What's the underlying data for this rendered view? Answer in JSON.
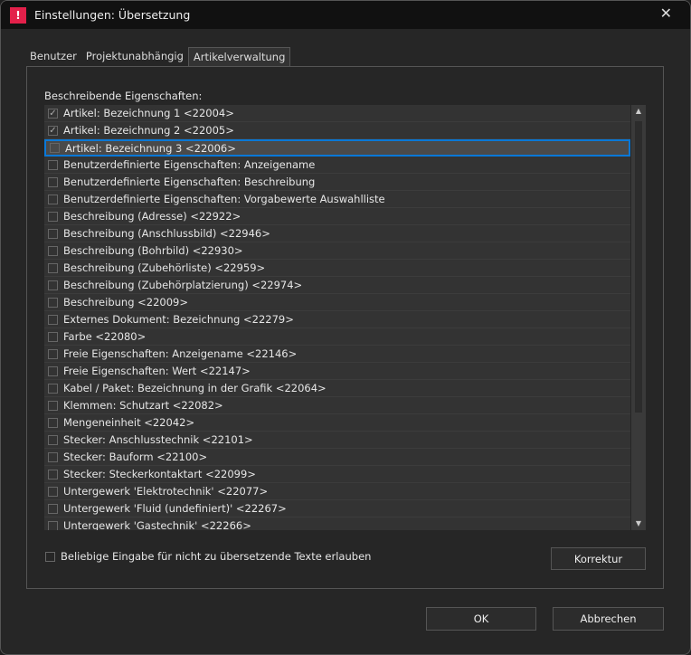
{
  "window": {
    "title": "Einstellungen: Übersetzung",
    "logo": "!",
    "close": "✕"
  },
  "tabs": [
    {
      "label": "Benutzer"
    },
    {
      "label": "Projektunabhängig"
    },
    {
      "label": "Artikelverwaltung"
    }
  ],
  "list_label": "Beschreibende Eigenschaften:",
  "items": [
    {
      "label": "Artikel: Bezeichnung 1 <22004>",
      "checked": true
    },
    {
      "label": "Artikel: Bezeichnung 2 <22005>",
      "checked": true
    },
    {
      "label": "Artikel: Bezeichnung 3 <22006>",
      "checked": false
    },
    {
      "label": "Benutzerdefinierte Eigenschaften: Anzeigename",
      "checked": false
    },
    {
      "label": "Benutzerdefinierte Eigenschaften: Beschreibung",
      "checked": false
    },
    {
      "label": "Benutzerdefinierte Eigenschaften: Vorgabewerte Auswahlliste",
      "checked": false
    },
    {
      "label": "Beschreibung (Adresse) <22922>",
      "checked": false
    },
    {
      "label": "Beschreibung (Anschlussbild) <22946>",
      "checked": false
    },
    {
      "label": "Beschreibung (Bohrbild) <22930>",
      "checked": false
    },
    {
      "label": "Beschreibung (Zubehörliste) <22959>",
      "checked": false
    },
    {
      "label": "Beschreibung (Zubehörplatzierung) <22974>",
      "checked": false
    },
    {
      "label": "Beschreibung <22009>",
      "checked": false
    },
    {
      "label": "Externes Dokument: Bezeichnung <22279>",
      "checked": false
    },
    {
      "label": "Farbe <22080>",
      "checked": false
    },
    {
      "label": "Freie Eigenschaften: Anzeigename <22146>",
      "checked": false
    },
    {
      "label": "Freie Eigenschaften: Wert <22147>",
      "checked": false
    },
    {
      "label": "Kabel / Paket: Bezeichnung in der Grafik <22064>",
      "checked": false
    },
    {
      "label": "Klemmen: Schutzart <22082>",
      "checked": false
    },
    {
      "label": "Mengeneinheit <22042>",
      "checked": false
    },
    {
      "label": "Stecker: Anschlusstechnik <22101>",
      "checked": false
    },
    {
      "label": "Stecker: Bauform <22100>",
      "checked": false
    },
    {
      "label": "Stecker: Steckerkontaktart <22099>",
      "checked": false
    },
    {
      "label": "Untergewerk 'Elektrotechnik' <22077>",
      "checked": false
    },
    {
      "label": "Untergewerk 'Fluid (undefiniert)' <22267>",
      "checked": false
    },
    {
      "label": "Untergewerk 'Gastechnik' <22266>",
      "checked": false
    }
  ],
  "selected_index": 2,
  "allow_input": {
    "label": "Beliebige Eingabe für nicht zu übersetzende Texte erlauben",
    "checked": false
  },
  "buttons": {
    "korrektur": "Korrektur",
    "ok": "OK",
    "cancel": "Abbrechen"
  }
}
